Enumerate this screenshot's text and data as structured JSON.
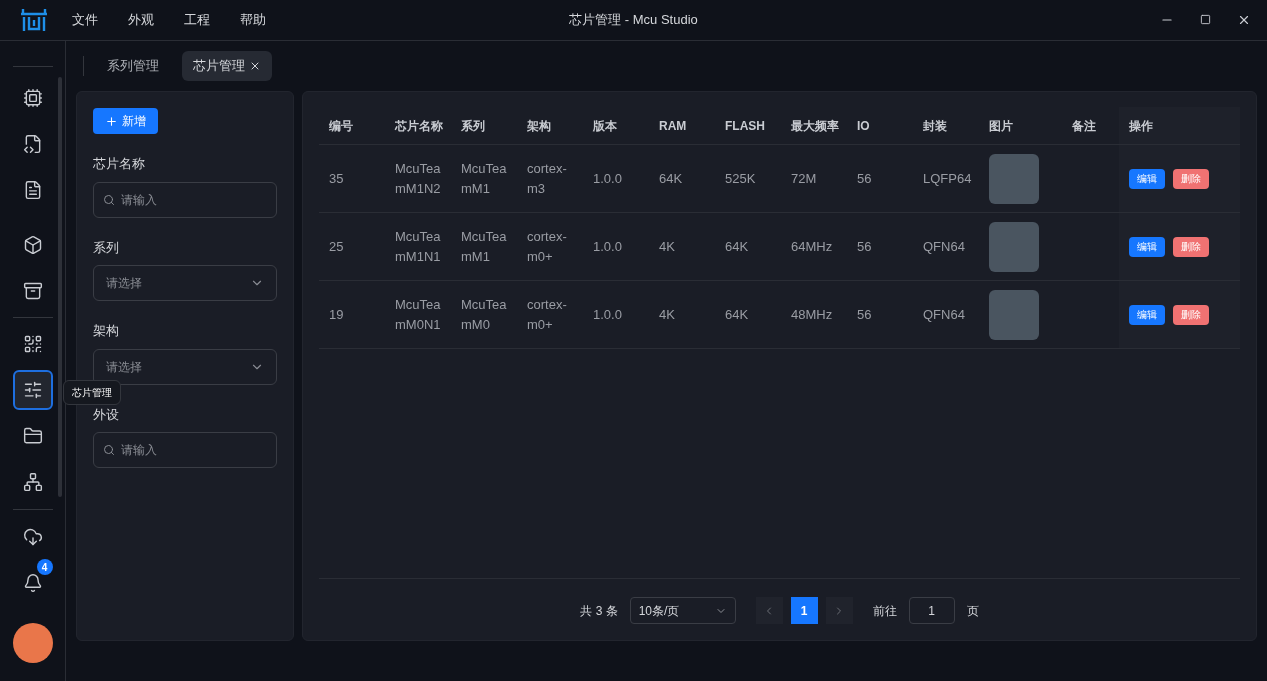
{
  "window": {
    "title": "芯片管理 - Mcu Studio"
  },
  "menu": [
    "文件",
    "外观",
    "工程",
    "帮助"
  ],
  "sidebar": {
    "items": [
      {
        "kind": "chip",
        "selected": false
      },
      {
        "kind": "code",
        "selected": false
      },
      {
        "kind": "file",
        "selected": false
      },
      {
        "kind": "cube",
        "selected": false
      },
      {
        "kind": "archive",
        "selected": false
      },
      {
        "kind": "scan",
        "selected": false
      },
      {
        "kind": "sliders",
        "selected": true
      },
      {
        "kind": "folder",
        "selected": false
      },
      {
        "kind": "tree",
        "selected": false
      },
      {
        "kind": "download",
        "selected": false
      },
      {
        "kind": "bell",
        "selected": false,
        "badge": "4"
      }
    ],
    "tooltip": "芯片管理"
  },
  "tabs": [
    {
      "label": "系列管理",
      "selected": false
    },
    {
      "label": "芯片管理",
      "selected": true,
      "closable": true
    }
  ],
  "filter": {
    "add_button": "新增",
    "fields": [
      {
        "label": "芯片名称",
        "kind": "search",
        "placeholder": "请输入"
      },
      {
        "label": "系列",
        "kind": "select",
        "placeholder": "请选择"
      },
      {
        "label": "架构",
        "kind": "select",
        "placeholder": "请选择"
      },
      {
        "label": "外设",
        "kind": "search",
        "placeholder": "请输入"
      }
    ]
  },
  "table": {
    "columns": [
      "编号",
      "芯片名称",
      "系列",
      "架构",
      "版本",
      "RAM",
      "FLASH",
      "最大频率",
      "IO",
      "封装",
      "图片",
      "备注",
      "操作"
    ],
    "rows": [
      {
        "cells": [
          "35",
          "McuTeamM1N2",
          "McuTeamM1",
          "cortex-m3",
          "1.0.0",
          "64K",
          "525K",
          "72M",
          "56",
          "LQFP64"
        ],
        "actions": [
          "编辑",
          "删除"
        ]
      },
      {
        "cells": [
          "25",
          "McuTeamM1N1",
          "McuTeamM1",
          "cortex-m0+",
          "1.0.0",
          "4K",
          "64K",
          "64MHz",
          "56",
          "QFN64"
        ],
        "actions": [
          "编辑",
          "删除"
        ]
      },
      {
        "cells": [
          "19",
          "McuTeamM0N1",
          "McuTeamM0",
          "cortex-m0+",
          "1.0.0",
          "4K",
          "64K",
          "48MHz",
          "56",
          "QFN64"
        ],
        "actions": [
          "编辑",
          "删除"
        ]
      }
    ]
  },
  "pagination": {
    "total": "共 3 条",
    "page_size": "10条/页",
    "pages": [
      {
        "label": "1",
        "selected": true
      }
    ],
    "goto_label": "前往",
    "goto_value": "1",
    "page_suffix": "页"
  }
}
